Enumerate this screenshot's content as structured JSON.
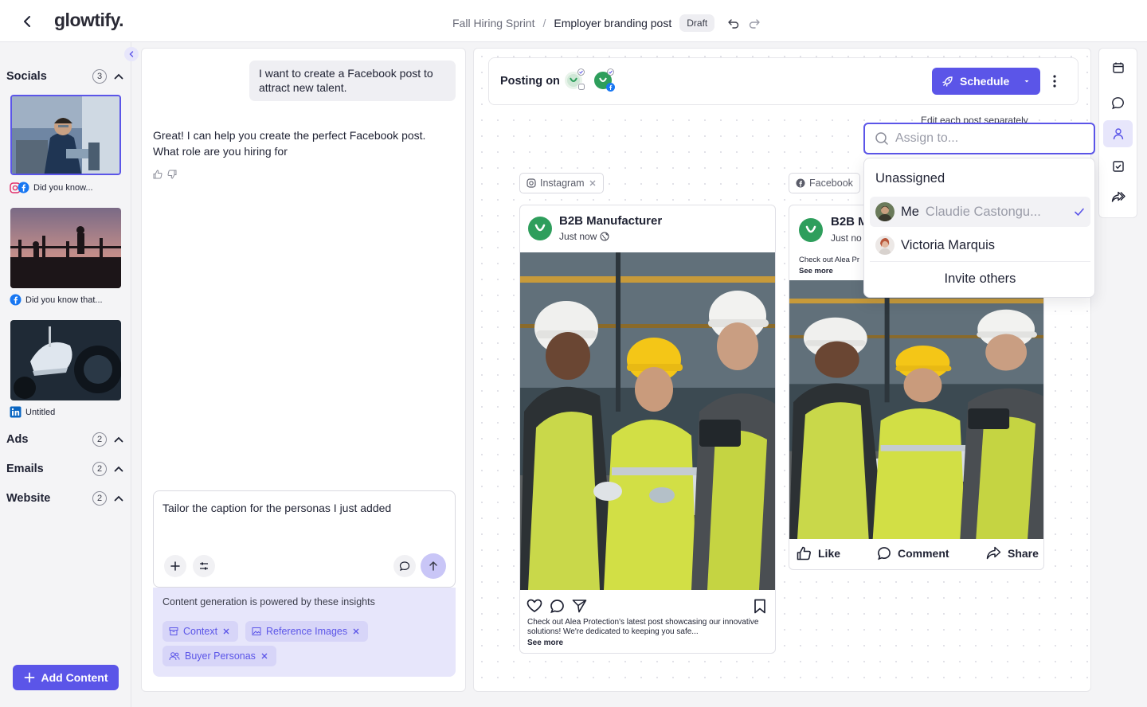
{
  "app": {
    "logo": "glowtify."
  },
  "breadcrumb": {
    "project": "Fall Hiring Sprint",
    "separator": "/",
    "page": "Employer branding post",
    "status": "Draft"
  },
  "sidebar": {
    "sections": [
      {
        "title": "Socials",
        "count": "3"
      },
      {
        "title": "Ads",
        "count": "2"
      },
      {
        "title": "Emails",
        "count": "2"
      },
      {
        "title": "Website",
        "count": "2"
      }
    ],
    "items": [
      {
        "caption": "Did you know..."
      },
      {
        "caption": "Did you know that..."
      },
      {
        "caption": "Untitled"
      }
    ],
    "add_content": "Add Content"
  },
  "chat": {
    "user_message": "I want to create a Facebook post to attract new talent.",
    "ai_message": "Great! I can help you create the perfect Facebook post. What role are you hiring for",
    "composer_text": "Tailor the caption for the personas I just added",
    "insights_title": "Content generation is powered by these insights",
    "chips": [
      {
        "label": "Context"
      },
      {
        "label": "Reference Images"
      },
      {
        "label": "Buyer Personas"
      }
    ]
  },
  "canvas": {
    "posting_on": "Posting on",
    "schedule": "Schedule",
    "edit_separately": "Edit each post separately",
    "instagram": {
      "tag": "Instagram",
      "name": "B2B Manufacturer",
      "time": "Just now",
      "caption": "Check out Alea Protection's latest post showcasing our innovative solutions! We're dedicated to keeping you safe...",
      "see_more": "See more"
    },
    "facebook": {
      "tag": "Facebook",
      "name": "B2B M",
      "time": "Just no",
      "caption": "Check out Alea Pr",
      "see_more": "See more",
      "like": "Like",
      "comment": "Comment",
      "share": "Share"
    }
  },
  "assign": {
    "placeholder": "Assign to...",
    "unassigned": "Unassigned",
    "me_label": "Me",
    "me_name": "Claudie Castongu...",
    "other": "Victoria Marquis",
    "invite": "Invite others"
  },
  "colors": {
    "accent": "#5b55e8",
    "accent_light": "#e7e6fb",
    "brand_green": "#2e9e5c",
    "facebook": "#1877f2",
    "linkedin": "#0a66c2"
  }
}
